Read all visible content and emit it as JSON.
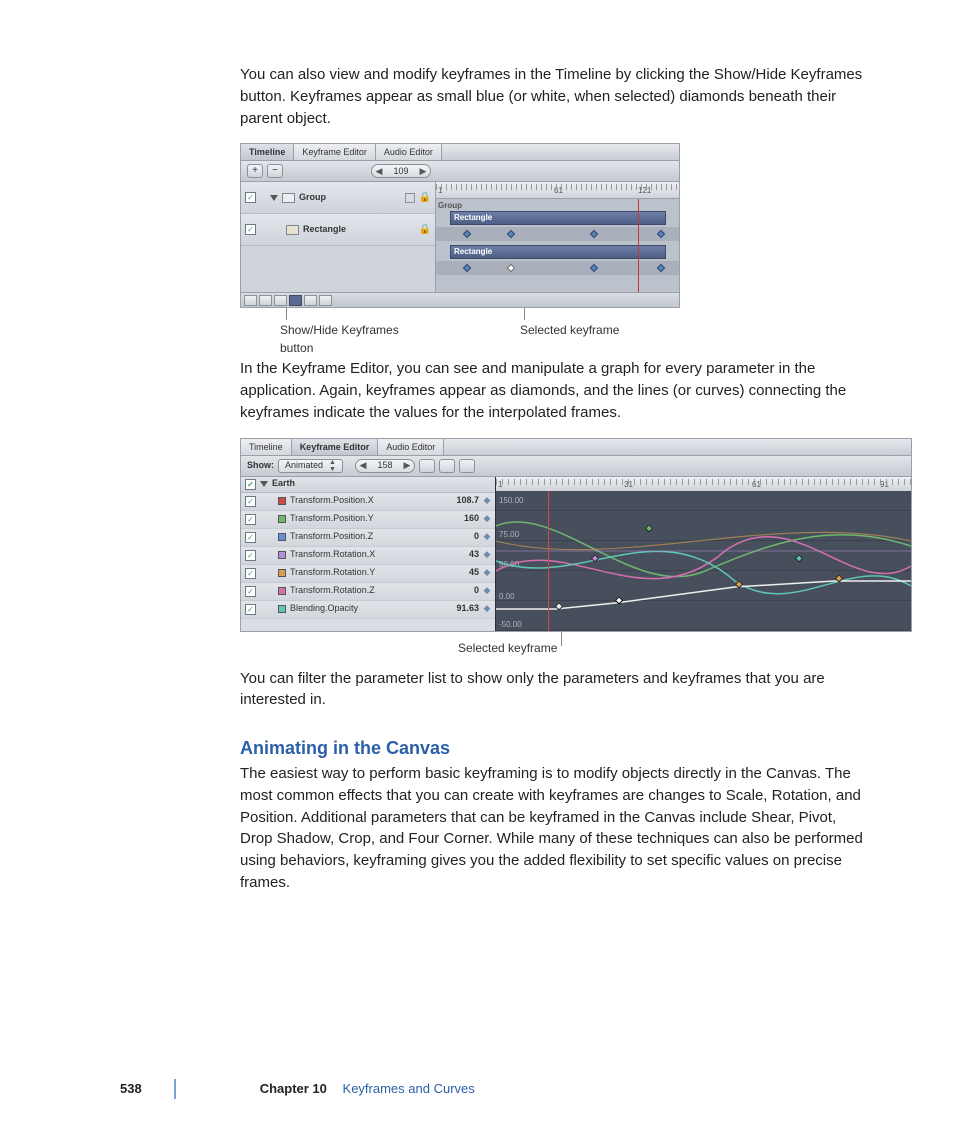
{
  "para1": "You can also view and modify keyframes in the Timeline by clicking the Show/Hide Keyframes button. Keyframes appear as small blue (or white, when selected) diamonds beneath their parent object.",
  "para2": "In the Keyframe Editor, you can see and manipulate a graph for every parameter in the application. Again, keyframes appear as diamonds, and the lines (or curves) connecting the keyframes indicate the values for the interpolated frames.",
  "para3": "You can filter the parameter list to show only the parameters and keyframes that you are interested in.",
  "section_heading": "Animating in the Canvas",
  "para4": "The easiest way to perform basic keyframing is to modify objects directly in the Canvas. The most common effects that you can create with keyframes are changes to Scale, Rotation, and Position. Additional parameters that can be keyframed in the Canvas include Shear, Pivot, Drop Shadow, Crop, and Four Corner. While many of these techniques can also be performed using behaviors, keyframing gives you the added flexibility to set specific values on precise frames.",
  "fig1": {
    "tabs": [
      "Timeline",
      "Keyframe Editor",
      "Audio Editor"
    ],
    "plus": "+",
    "minus": "−",
    "frame": "109",
    "ruler": {
      "start": "1",
      "t1": "61",
      "t2": "121"
    },
    "group_hdr": "Group",
    "layers": {
      "group": "Group",
      "rect": "Rectangle"
    },
    "clip": "Rectangle",
    "callouts": {
      "left": "Show/Hide Keyframes\nbutton",
      "right": "Selected keyframe"
    }
  },
  "fig2": {
    "tabs": [
      "Timeline",
      "Keyframe Editor",
      "Audio Editor"
    ],
    "show_label": "Show:",
    "show_value": "Animated",
    "frame": "158",
    "earth": "Earth",
    "params": [
      {
        "name": "Transform.Position.X",
        "val": "108.7",
        "color": "#cc4b4b"
      },
      {
        "name": "Transform.Position.Y",
        "val": "160",
        "color": "#6db86d"
      },
      {
        "name": "Transform.Position.Z",
        "val": "0",
        "color": "#6a8fd6"
      },
      {
        "name": "Transform.Rotation.X",
        "val": "43",
        "color": "#b78fd6"
      },
      {
        "name": "Transform.Rotation.Y",
        "val": "45",
        "color": "#d8a050"
      },
      {
        "name": "Transform.Rotation.Z",
        "val": "0",
        "color": "#d66fb0"
      },
      {
        "name": "Blending.Opacity",
        "val": "91.63",
        "color": "#5fc7b5"
      }
    ],
    "ruler": {
      "start": "1",
      "t1": "31",
      "t2": "61",
      "t3": "91"
    },
    "ylabels": [
      "150.00",
      "75.00",
      "50.00",
      "0.00",
      "-50.00"
    ],
    "callout": "Selected keyframe"
  },
  "footer": {
    "page": "538",
    "chapter": "Chapter 10",
    "title": "Keyframes and Curves"
  }
}
